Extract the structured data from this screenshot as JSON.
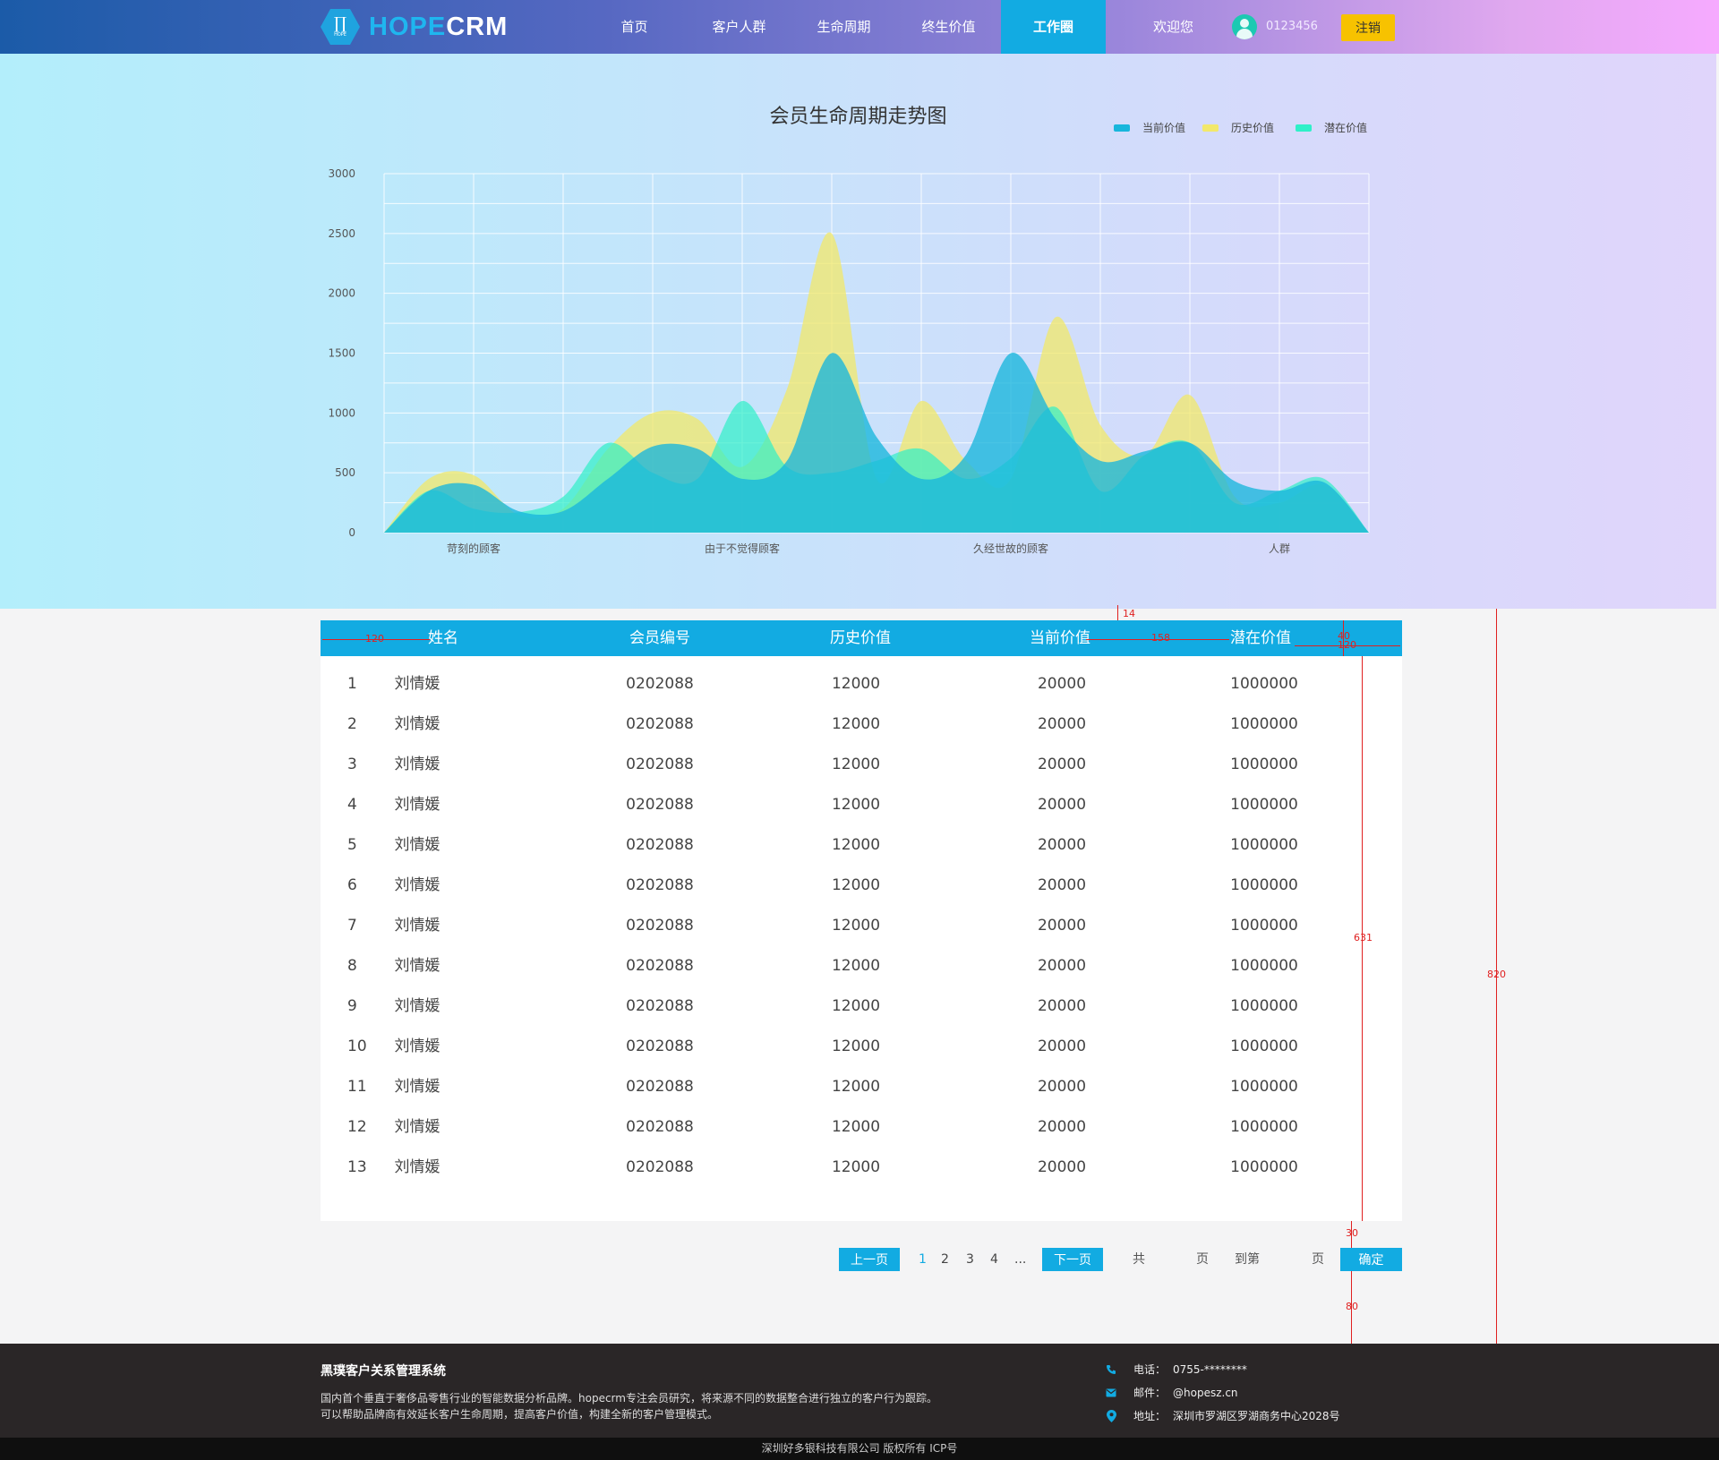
{
  "header": {
    "logo_text_a": "HOPE",
    "logo_text_b": "CRM",
    "logo_glyph": "∏",
    "logo_small": "HOPE",
    "nav": [
      {
        "label": "首页"
      },
      {
        "label": "客户人群"
      },
      {
        "label": "生命周期"
      },
      {
        "label": "终生价值"
      },
      {
        "label": "工作圈",
        "active": true
      }
    ],
    "welcome": "欢迎您",
    "user_id": "0123456",
    "logout_label": "注销",
    "accent_color": "#12abe2",
    "logout_color": "#f7c200"
  },
  "chart_data": {
    "type": "area",
    "title": "会员生命周期走势图",
    "legend_position": "top-right",
    "grid": true,
    "ylim": [
      0,
      3000
    ],
    "yticks": [
      "0",
      "500",
      "1000",
      "1500",
      "2000",
      "2500",
      "3000"
    ],
    "xticks": [
      "苛刻的顾客",
      "由于不觉得顾客",
      "久经世故的顾客",
      "人群"
    ],
    "x": [
      0,
      0.5,
      1,
      1.5,
      2,
      2.5,
      3,
      3.5,
      4,
      4.5,
      5,
      5.5,
      6,
      6.5,
      7,
      7.5,
      8,
      8.5,
      9,
      9.5,
      10,
      10.5,
      11
    ],
    "series": [
      {
        "name": "当前价值",
        "color": "#18b6dc",
        "values": [
          0,
          350,
          400,
          180,
          180,
          450,
          720,
          700,
          450,
          600,
          1500,
          800,
          450,
          650,
          1500,
          950,
          600,
          680,
          750,
          430,
          350,
          420,
          0
        ]
      },
      {
        "name": "历史价值",
        "color": "#f2e86a",
        "values": [
          0,
          450,
          480,
          150,
          200,
          700,
          1000,
          950,
          550,
          1200,
          2500,
          450,
          1100,
          600,
          450,
          1800,
          900,
          650,
          1150,
          300,
          250,
          400,
          0
        ]
      },
      {
        "name": "潜在价值",
        "color": "#2ff0c8",
        "values": [
          0,
          350,
          200,
          170,
          300,
          750,
          500,
          450,
          1100,
          550,
          500,
          600,
          700,
          450,
          620,
          1050,
          350,
          650,
          750,
          250,
          350,
          450,
          0
        ]
      }
    ]
  },
  "table": {
    "headers": [
      "姓名",
      "会员编号",
      "历史价值",
      "当前价值",
      "潜在价值"
    ],
    "rows": [
      [
        "1",
        "刘情媛",
        "0202088",
        "12000",
        "20000",
        "1000000"
      ],
      [
        "2",
        "刘情媛",
        "0202088",
        "12000",
        "20000",
        "1000000"
      ],
      [
        "3",
        "刘情媛",
        "0202088",
        "12000",
        "20000",
        "1000000"
      ],
      [
        "4",
        "刘情媛",
        "0202088",
        "12000",
        "20000",
        "1000000"
      ],
      [
        "5",
        "刘情媛",
        "0202088",
        "12000",
        "20000",
        "1000000"
      ],
      [
        "6",
        "刘情媛",
        "0202088",
        "12000",
        "20000",
        "1000000"
      ],
      [
        "7",
        "刘情媛",
        "0202088",
        "12000",
        "20000",
        "1000000"
      ],
      [
        "8",
        "刘情媛",
        "0202088",
        "12000",
        "20000",
        "1000000"
      ],
      [
        "9",
        "刘情媛",
        "0202088",
        "12000",
        "20000",
        "1000000"
      ],
      [
        "10",
        "刘情媛",
        "0202088",
        "12000",
        "20000",
        "1000000"
      ],
      [
        "11",
        "刘情媛",
        "0202088",
        "12000",
        "20000",
        "1000000"
      ],
      [
        "12",
        "刘情媛",
        "0202088",
        "12000",
        "20000",
        "1000000"
      ],
      [
        "13",
        "刘情媛",
        "0202088",
        "12000",
        "20000",
        "1000000"
      ]
    ]
  },
  "pagination": {
    "prev_label": "上一页",
    "pages": [
      "1",
      "2",
      "3",
      "4"
    ],
    "current_page": "1",
    "ellipsis": "...",
    "next_label": "下一页",
    "total_prefix": "共",
    "total_suffix": "页",
    "goto_prefix": "到第",
    "goto_suffix": "页",
    "confirm_label": "确定"
  },
  "annotations": [
    "120",
    "14",
    "158",
    "40",
    "120",
    "631",
    "30",
    "80",
    "820"
  ],
  "footer": {
    "title": "黑璞客户关系管理系统",
    "desc_line1": "国内首个垂直于奢侈品零售行业的智能数据分析品牌。hopecrm专注会员研究，将来源不同的数据整合进行独立的客户行为跟踪。",
    "desc_line2": "可以帮助品牌商有效延长客户生命周期，提高客户价值，构建全新的客户管理模式。",
    "phone_label": "电话：",
    "phone": "0755-********",
    "email_label": "邮件：",
    "email": "@hopesz.cn",
    "address_label": "地址：",
    "address": "深圳市罗湖区罗湖商务中心2028号",
    "icons": [
      "phone-icon",
      "mail-icon",
      "location-icon"
    ]
  },
  "copyright": "深圳好多银科技有限公司 版权所有 ICP号"
}
